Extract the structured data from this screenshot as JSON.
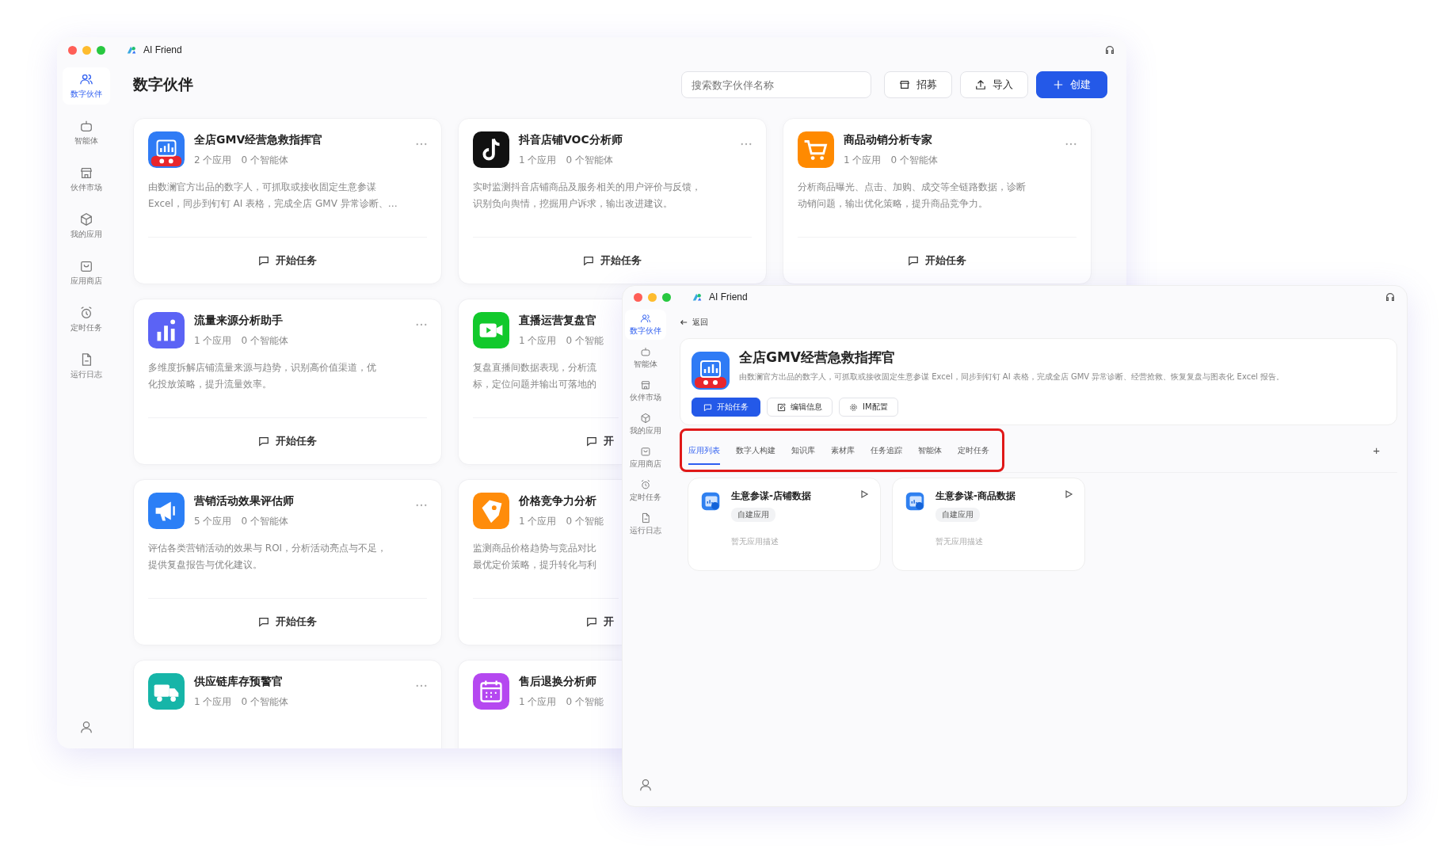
{
  "back_window": {
    "app_name": "AI Friend",
    "sidebar": [
      {
        "label": "数字伙伴",
        "kind": "people",
        "selected": true
      },
      {
        "label": "智能体",
        "kind": "robot",
        "selected": false
      },
      {
        "label": "伙伴市场",
        "kind": "store",
        "selected": false
      },
      {
        "label": "我的应用",
        "kind": "cube",
        "selected": false
      },
      {
        "label": "应用商店",
        "kind": "bag",
        "selected": false
      },
      {
        "label": "定时任务",
        "kind": "alarm",
        "selected": false
      },
      {
        "label": "运行日志",
        "kind": "doc",
        "selected": false
      }
    ],
    "page_title": "数字伙伴",
    "search": {
      "placeholder": "搜索数字伙伴名称"
    },
    "buttons": [
      {
        "label": "招募",
        "kind": "recruit"
      },
      {
        "label": "导入",
        "kind": "import"
      },
      {
        "label": "创建",
        "kind": "create"
      }
    ],
    "card_rows": [
      [
        {
          "title": "全店GMV经营急救指挥官",
          "apps": "2 个应用",
          "agents": "0 个智能体",
          "kind": "gmv",
          "color": "#2f7bf5",
          "more": true,
          "desc_lines": [
            "由数澜官方出品的数字人，可抓取或接收固定生意参谋",
            "Excel，同步到钉钉 AI 表格，完成全店 GMV 异常诊断、…"
          ],
          "action": "开始任务"
        },
        {
          "title": "抖音店铺VOC分析师",
          "apps": "1 个应用",
          "agents": "0 个智能体",
          "kind": "tiktok",
          "color": "#111111",
          "more": true,
          "desc_lines": [
            "实时监测抖音店铺商品及服务相关的用户评价与反馈，",
            "识别负向舆情，挖掘用户诉求，输出改进建议。"
          ],
          "action": "开始任务"
        },
        {
          "title": "商品动销分析专家",
          "apps": "1 个应用",
          "agents": "0 个智能体",
          "kind": "cart",
          "color": "#ff8a00",
          "more": true,
          "desc_lines": [
            "分析商品曝光、点击、加购、成交等全链路数据，诊断",
            "动销问题，输出优化策略，提升商品竞争力。"
          ],
          "action": "开始任务"
        }
      ],
      [
        {
          "title": "流量来源分析助手",
          "apps": "1 个应用",
          "agents": "0 个智能体",
          "kind": "bars",
          "color": "#5b63f5",
          "more": true,
          "desc_lines": [
            "多维度拆解店铺流量来源与趋势，识别高价值渠道，优",
            "化投放策略，提升流量效率。"
          ],
          "action": "开始任务"
        },
        {
          "title": "直播运营复盘官",
          "apps": "1 个应用",
          "agents": "0 个智能",
          "kind": "video",
          "color": "#12c92c",
          "more": false,
          "desc_lines": [
            "复盘直播间数据表现，分析流",
            "标，定位问题并输出可落地的"
          ],
          "action": "开"
        }
      ],
      [
        {
          "title": "营销活动效果评估师",
          "apps": "5 个应用",
          "agents": "0 个智能体",
          "kind": "megaphone",
          "color": "#2b7ff6",
          "more": true,
          "desc_lines": [
            "评估各类营销活动的效果与 ROI，分析活动亮点与不足，",
            "提供复盘报告与优化建议。"
          ],
          "action": "开始任务"
        },
        {
          "title": "价格竞争力分析",
          "apps": "1 个应用",
          "agents": "0 个智能",
          "kind": "tag",
          "color": "#ff8c0a",
          "more": false,
          "desc_lines": [
            "监测商品价格趋势与竞品对比",
            "最优定价策略，提升转化与利"
          ],
          "action": "开"
        }
      ],
      [
        {
          "title": "供应链库存预警官",
          "apps": "1 个应用",
          "agents": "0 个智能体",
          "kind": "truck",
          "color": "#16b5a8",
          "more": true
        },
        {
          "title": "售后退换分析师",
          "apps": "1 个应用",
          "agents": "0 个智能",
          "kind": "calendar",
          "color": "#b548f0",
          "more": false
        }
      ]
    ]
  },
  "front_window": {
    "app_name": "AI Friend",
    "sidebar": [
      {
        "label": "数字伙伴",
        "kind": "people",
        "selected": true
      },
      {
        "label": "智能体",
        "kind": "robot",
        "selected": false
      },
      {
        "label": "伙伴市场",
        "kind": "store",
        "selected": false
      },
      {
        "label": "我的应用",
        "kind": "cube",
        "selected": false
      },
      {
        "label": "应用商店",
        "kind": "bag",
        "selected": false
      },
      {
        "label": "定时任务",
        "kind": "alarm",
        "selected": false
      },
      {
        "label": "运行日志",
        "kind": "doc",
        "selected": false
      }
    ],
    "back_link": "返回",
    "partner": {
      "title": "全店GMV经营急救指挥官",
      "kind": "gmv",
      "color": "#2f7bf5",
      "description": "由数澜官方出品的数字人，可抓取或接收固定生意参谋 Excel，同步到钉钉 AI 表格，完成全店 GMV 异常诊断、经营抢救、恢复复盘与图表化 Excel 报告。"
    },
    "actions": [
      {
        "label": "开始任务",
        "kind": "start"
      },
      {
        "label": "编辑信息",
        "kind": "edit"
      },
      {
        "label": "IM配置",
        "kind": "im"
      }
    ],
    "tabs_highlighted": true,
    "tabs": [
      {
        "label": "应用列表",
        "selected": true
      },
      {
        "label": "数字人构建",
        "selected": false
      },
      {
        "label": "知识库",
        "selected": false
      },
      {
        "label": "素材库",
        "selected": false
      },
      {
        "label": "任务追踪",
        "selected": false
      },
      {
        "label": "智能体",
        "selected": false
      },
      {
        "label": "定时任务",
        "selected": false
      }
    ],
    "add_tab": "+",
    "apps": [
      {
        "name": "生意参谋-店铺数据",
        "tag": "自建应用",
        "description": "暂无应用描述"
      },
      {
        "name": "生意参谋-商品数据",
        "tag": "自建应用",
        "description": "暂无应用描述"
      }
    ]
  }
}
